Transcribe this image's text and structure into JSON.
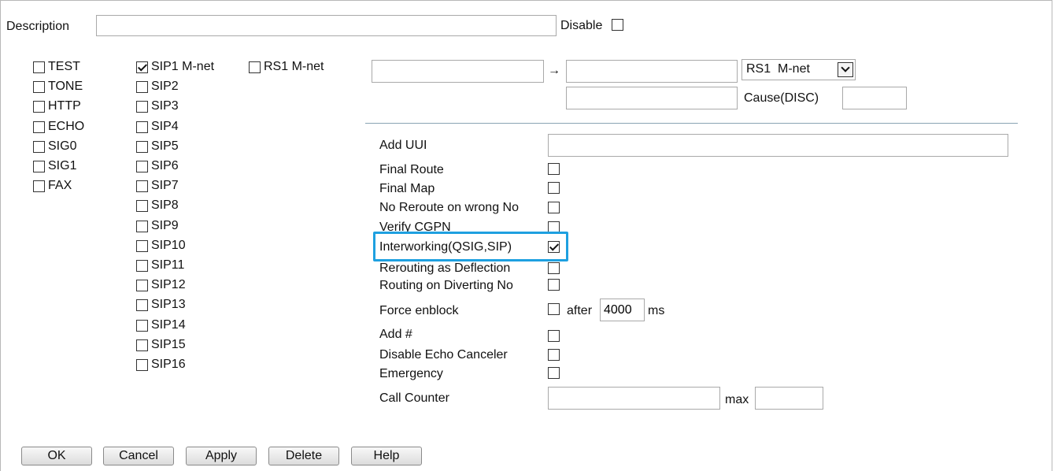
{
  "description": {
    "label": "Description",
    "value": "",
    "disable_label": "Disable",
    "disabled": false
  },
  "services": [
    {
      "label": "TEST",
      "checked": false
    },
    {
      "label": "TONE",
      "checked": false
    },
    {
      "label": "HTTP",
      "checked": false
    },
    {
      "label": "ECHO",
      "checked": false
    },
    {
      "label": "SIG0",
      "checked": false
    },
    {
      "label": "SIG1",
      "checked": false
    },
    {
      "label": "FAX",
      "checked": false
    }
  ],
  "sip": [
    {
      "label": "SIP1 M-net",
      "checked": true
    },
    {
      "label": "SIP2",
      "checked": false
    },
    {
      "label": "SIP3",
      "checked": false
    },
    {
      "label": "SIP4",
      "checked": false
    },
    {
      "label": "SIP5",
      "checked": false
    },
    {
      "label": "SIP6",
      "checked": false
    },
    {
      "label": "SIP7",
      "checked": false
    },
    {
      "label": "SIP8",
      "checked": false
    },
    {
      "label": "SIP9",
      "checked": false
    },
    {
      "label": "SIP10",
      "checked": false
    },
    {
      "label": "SIP11",
      "checked": false
    },
    {
      "label": "SIP12",
      "checked": false
    },
    {
      "label": "SIP13",
      "checked": false
    },
    {
      "label": "SIP14",
      "checked": false
    },
    {
      "label": "SIP15",
      "checked": false
    },
    {
      "label": "SIP16",
      "checked": false
    }
  ],
  "rs1": {
    "label": "RS1 M-net",
    "checked": false
  },
  "mapping": {
    "from_value": "",
    "arrow": "→",
    "to_value": "",
    "interface_selected": "RS1  M-net",
    "cause_value": "",
    "cause_label": "Cause(DISC)",
    "cause_disc_value": ""
  },
  "options": {
    "add_uui": {
      "label": "Add UUI",
      "value": ""
    },
    "final_route": {
      "label": "Final Route",
      "checked": false
    },
    "final_map": {
      "label": "Final Map",
      "checked": false
    },
    "no_reroute": {
      "label": "No Reroute on wrong No",
      "checked": false
    },
    "verify_cgpn": {
      "label": "Verify CGPN",
      "checked": false
    },
    "interworking": {
      "label": "Interworking(QSIG,SIP)",
      "checked": true
    },
    "rerouting_deflection": {
      "label": "Rerouting as Deflection",
      "checked": false
    },
    "routing_diverting": {
      "label": "Routing on Diverting No",
      "checked": false
    },
    "force_enblock": {
      "label": "Force enblock",
      "checked": false,
      "after_label": "after",
      "after_value": "4000",
      "unit": "ms"
    },
    "add_hash": {
      "label": "Add #",
      "checked": false
    },
    "disable_echo": {
      "label": "Disable Echo Canceler",
      "checked": false
    },
    "emergency": {
      "label": "Emergency",
      "checked": false
    },
    "call_counter": {
      "label": "Call Counter",
      "value": "",
      "max_label": "max",
      "max_value": ""
    }
  },
  "buttons": {
    "ok": "OK",
    "cancel": "Cancel",
    "apply": "Apply",
    "delete": "Delete",
    "help": "Help"
  },
  "colors": {
    "highlight": "#1ea0e0",
    "divider": "#8aa4b4"
  }
}
